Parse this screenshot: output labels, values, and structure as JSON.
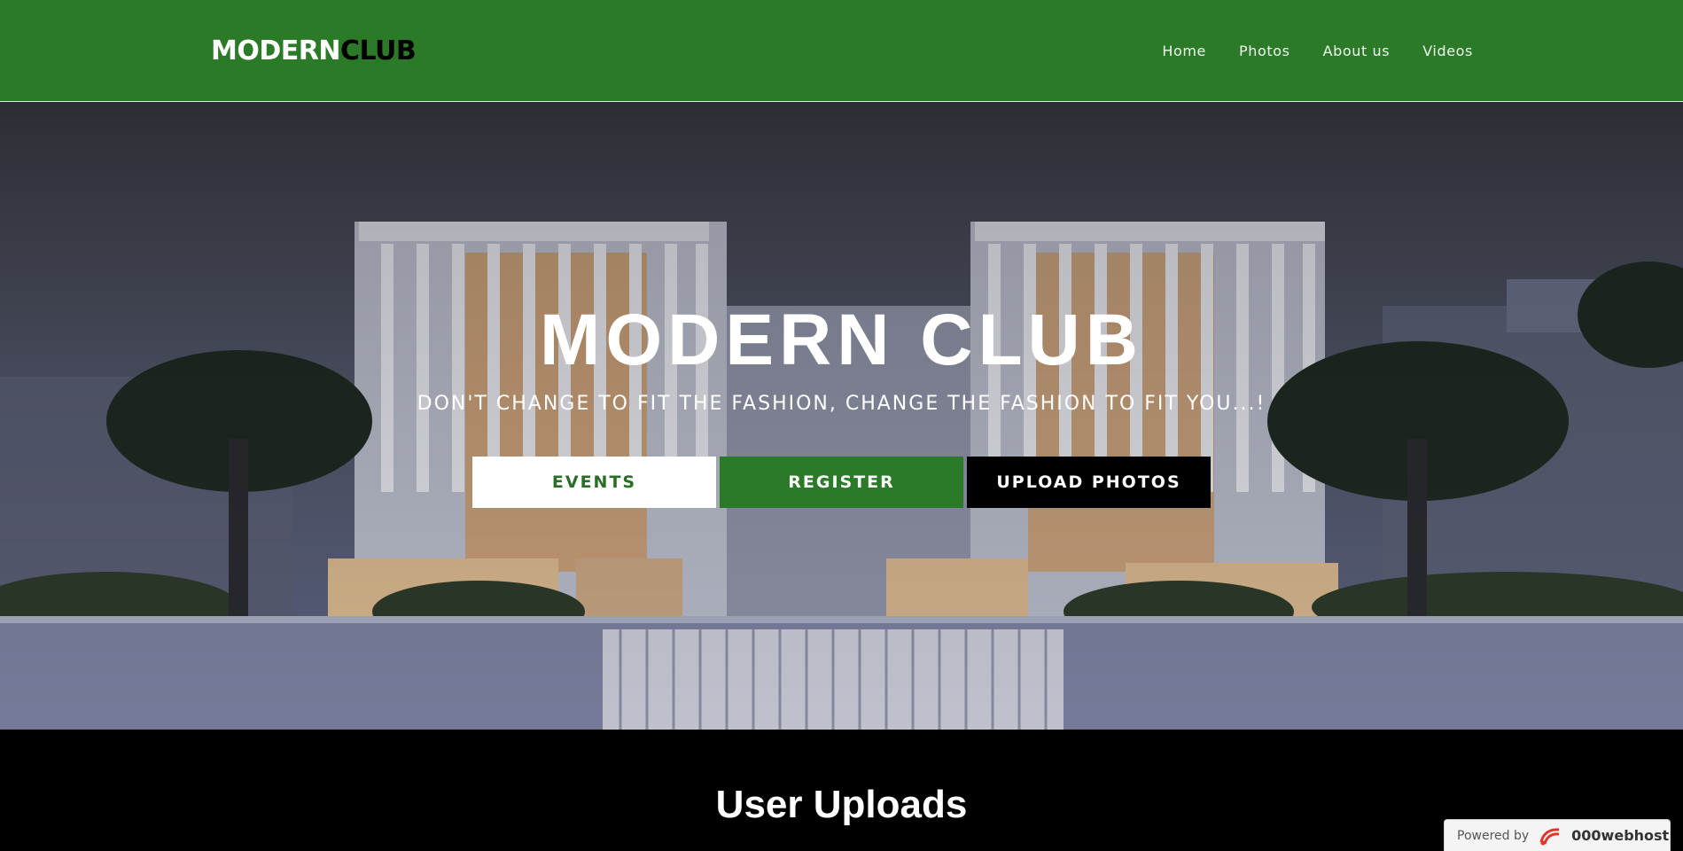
{
  "header": {
    "logo_part_a": "MODERN",
    "logo_part_b": "CLUB",
    "nav": [
      {
        "label": "Home"
      },
      {
        "label": "Photos"
      },
      {
        "label": "About us"
      },
      {
        "label": "Videos"
      }
    ]
  },
  "hero": {
    "title": "MODERN CLUB",
    "subtitle": "DON'T CHANGE TO FIT THE FASHION, CHANGE THE FASHION TO FIT YOU...!",
    "buttons": {
      "events": "EVENTS",
      "register": "REGISTER",
      "upload": "UPLOAD PHOTOS"
    }
  },
  "uploads": {
    "title": "User Uploads"
  },
  "badge": {
    "powered_by": "Powered by",
    "brand": "000webhost",
    "icon": "000webhost-logo-icon"
  },
  "colors": {
    "brand_green": "#2a7a28",
    "black": "#000000",
    "white": "#ffffff"
  }
}
